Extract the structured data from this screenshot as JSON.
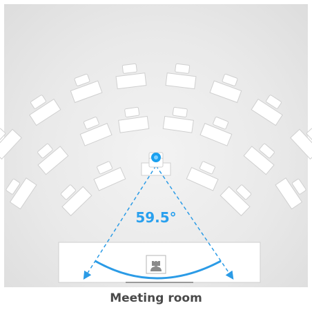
{
  "diagram": {
    "angle_label": "59.5°",
    "caption": "Meeting room",
    "colors": {
      "background": "#ececec",
      "accent": "#2b9be6",
      "angle_text": "#29a0ee",
      "seat_fill": "#ffffff",
      "seat_stroke": "#cfcfcf",
      "caption_text": "#4a4a4a"
    },
    "icons": {
      "camera": "camera-icon",
      "presenter": "person-at-desk-icon"
    }
  }
}
